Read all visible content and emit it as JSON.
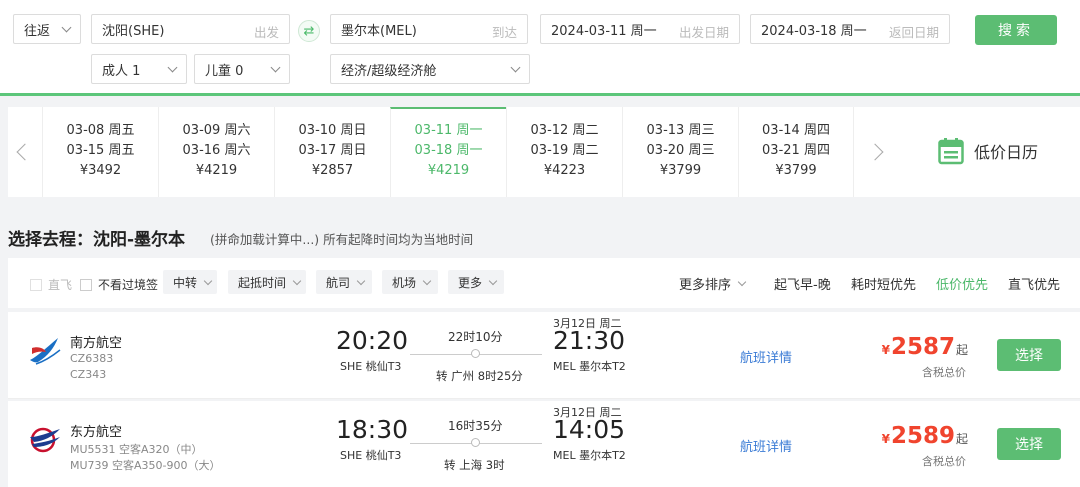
{
  "search": {
    "trip_type": "往返",
    "from_city": "沈阳(SHE)",
    "from_hint": "出发",
    "to_city": "墨尔本(MEL)",
    "to_hint": "到达",
    "depart_date": "2024-03-11 周一",
    "depart_hint": "出发日期",
    "return_date": "2024-03-18 周一",
    "return_hint": "返回日期",
    "search_label": "搜索",
    "adults": "成人 1",
    "children": "儿童 0",
    "cabin": "经济/超级经济舱"
  },
  "date_strip": [
    {
      "depart": "03-08 周五",
      "return": "03-15 周五",
      "price": "¥3492"
    },
    {
      "depart": "03-09 周六",
      "return": "03-16 周六",
      "price": "¥4219"
    },
    {
      "depart": "03-10 周日",
      "return": "03-17 周日",
      "price": "¥2857"
    },
    {
      "depart": "03-11 周一",
      "return": "03-18 周一",
      "price": "¥4219"
    },
    {
      "depart": "03-12 周二",
      "return": "03-19 周二",
      "price": "¥4223"
    },
    {
      "depart": "03-13 周三",
      "return": "03-20 周三",
      "price": "¥3799"
    },
    {
      "depart": "03-14 周四",
      "return": "03-21 周四",
      "price": "¥3799"
    }
  ],
  "low_price_calendar": "低价日历",
  "route": {
    "title": "选择去程：沈阳-墨尔本",
    "subtitle": "(拼命加载计算中...)  所有起降时间均为当地时间"
  },
  "filters": {
    "direct": "直飞",
    "no_transit_visa": "不看过境签",
    "transfer": "中转",
    "times": "起抵时间",
    "airline": "航司",
    "airport": "机场",
    "more": "更多"
  },
  "sorts": {
    "more_sort": "更多排序",
    "early_late": "起飞早-晚",
    "shortest": "耗时短优先",
    "cheapest": "低价优先",
    "direct_first": "直飞优先"
  },
  "flights": [
    {
      "airline": "南方航空",
      "code1": "CZ6383",
      "code2": "CZ343",
      "dep_time": "20:20",
      "dep_airport": "SHE 桃仙T3",
      "duration": "22时10分",
      "transfer": "转 广州 8时25分",
      "next_day": "3月12日 周二",
      "arr_time": "21:30",
      "arr_airport": "MEL 墨尔本T2",
      "detail": "航班详情",
      "yen": "¥",
      "price": "2587",
      "qi": "起",
      "tax": "含税总价",
      "choose": "选择",
      "logo_color": "#1a6fc4"
    },
    {
      "airline": "东方航空",
      "code1": "MU5531 空客A320（中）",
      "code2": "MU739 空客A350-900（大）",
      "dep_time": "18:30",
      "dep_airport": "SHE 桃仙T3",
      "duration": "16时35分",
      "transfer": "转 上海 3时",
      "next_day": "3月12日 周二",
      "arr_time": "14:05",
      "arr_airport": "MEL 墨尔本T2",
      "detail": "航班详情",
      "yen": "¥",
      "price": "2589",
      "qi": "起",
      "tax": "含税总价",
      "choose": "选择",
      "logo_color": "#c8102e"
    }
  ],
  "colors": {
    "accent": "#5cbd73",
    "price": "#f0442e",
    "link": "#3a7bd5"
  }
}
